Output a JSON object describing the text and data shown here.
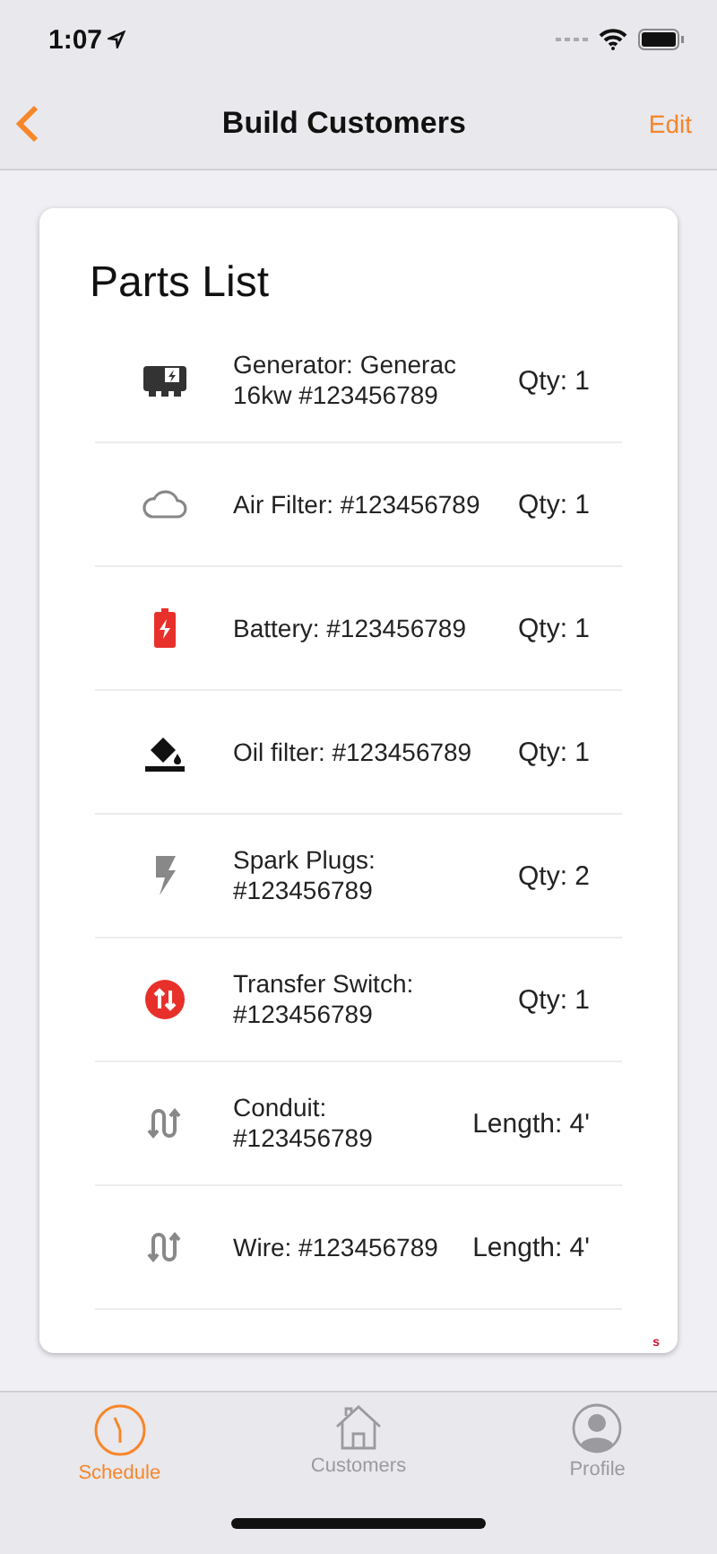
{
  "status_bar": {
    "time": "1:07"
  },
  "nav": {
    "title": "Build Customers",
    "action": "Edit"
  },
  "card": {
    "title": "Parts List",
    "corner_mark": "s"
  },
  "parts": [
    {
      "kind": "generator",
      "name": "Generator: Generac 16kw #123456789",
      "amount": "Qty: 1"
    },
    {
      "kind": "cloud",
      "name": "Air Filter: #123456789",
      "amount": "Qty: 1"
    },
    {
      "kind": "battery",
      "name": "Battery: #123456789",
      "amount": "Qty: 1"
    },
    {
      "kind": "bucket",
      "name": "Oil filter: #123456789",
      "amount": "Qty: 1"
    },
    {
      "kind": "bolt",
      "name": "Spark Plugs: #123456789",
      "amount": "Qty: 2"
    },
    {
      "kind": "transfer",
      "name": "Transfer Switch: #123456789",
      "amount": "Qty: 1"
    },
    {
      "kind": "wave",
      "name": "Conduit: #123456789",
      "amount": "Length: 4'"
    },
    {
      "kind": "wave",
      "name": "Wire: #123456789",
      "amount": "Length: 4'"
    }
  ],
  "tabs": [
    {
      "kind": "clock",
      "label": "Schedule",
      "selected": true
    },
    {
      "kind": "house",
      "label": "Customers",
      "selected": false
    },
    {
      "kind": "person",
      "label": "Profile",
      "selected": false
    }
  ]
}
